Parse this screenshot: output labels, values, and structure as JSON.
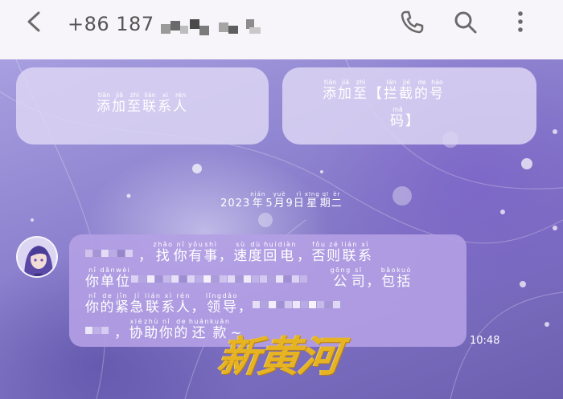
{
  "header": {
    "phone_prefix": "+86 187",
    "icons": {
      "back": "back-arrow-icon",
      "call": "phone-icon",
      "search": "search-icon",
      "more": "more-vertical-icon"
    },
    "icon_color": "#6b6b6b"
  },
  "actions": {
    "add_contact": {
      "chars": [
        "添",
        "加",
        "至",
        "联",
        "系",
        "人"
      ],
      "pinyin": [
        "tiān",
        "jiā",
        "zhì",
        "lián",
        "xì",
        "rén"
      ]
    },
    "add_blocked": {
      "line1_chars": [
        "添",
        "加",
        "至",
        "【",
        "拦",
        "截",
        "的",
        "号"
      ],
      "line1_pinyin": [
        "tiān",
        "jiā",
        "zhì",
        "",
        "lán",
        "jié",
        "de",
        "hào"
      ],
      "line2_chars": [
        "码",
        "】"
      ],
      "line2_pinyin": [
        "mǎ",
        ""
      ]
    }
  },
  "date_separator": {
    "chars": [
      "2023",
      "年",
      "5",
      "月",
      "9",
      "日",
      "星",
      "期",
      "二"
    ],
    "pinyin": [
      "",
      "nián",
      "",
      "yuè",
      "",
      "rì",
      "xīng",
      "qī",
      "èr"
    ]
  },
  "message": {
    "line1": {
      "chars": [
        "，",
        "找",
        "你",
        "有",
        "事",
        "，",
        "速",
        "度",
        "回",
        "电",
        "，",
        "否",
        "则",
        "联",
        "系"
      ],
      "pinyin": [
        "",
        "zhǎo",
        "nǐ",
        "yǒu",
        "shì",
        "",
        "sù",
        "dù",
        "huí",
        "diàn",
        "",
        "fǒu",
        "zé",
        "lián",
        "xì"
      ]
    },
    "line2a": {
      "chars": [
        "你",
        "单",
        "位"
      ],
      "pinyin": [
        "nǐ",
        "dān",
        "wèi"
      ]
    },
    "line2b": {
      "chars": [
        "公",
        "司",
        "，",
        "包",
        "括"
      ],
      "pinyin": [
        "gōng",
        "sī",
        "",
        "bāo",
        "kuò"
      ]
    },
    "line3a": {
      "chars": [
        "你",
        "的",
        "紧",
        "急",
        "联",
        "系",
        "人",
        "，",
        "领",
        "导",
        "，"
      ],
      "pinyin": [
        "nǐ",
        "de",
        "jǐn",
        "jí",
        "lián",
        "xì",
        "rén",
        "",
        "lǐng",
        "dǎo",
        ""
      ]
    },
    "line4": {
      "chars": [
        "，",
        "协",
        "助",
        "你",
        "的",
        "还",
        "款",
        "~"
      ],
      "pinyin": [
        "",
        "xié",
        "zhù",
        "nǐ",
        "de",
        "huán",
        "kuǎn",
        ""
      ]
    },
    "time": "10:48"
  },
  "watermark": "新黄河",
  "colors": {
    "header_bg": "#f7f5f9",
    "card_bg": "#ded6f4",
    "bubble_bg": "#b4a0e4",
    "watermark": "#e6b423"
  }
}
